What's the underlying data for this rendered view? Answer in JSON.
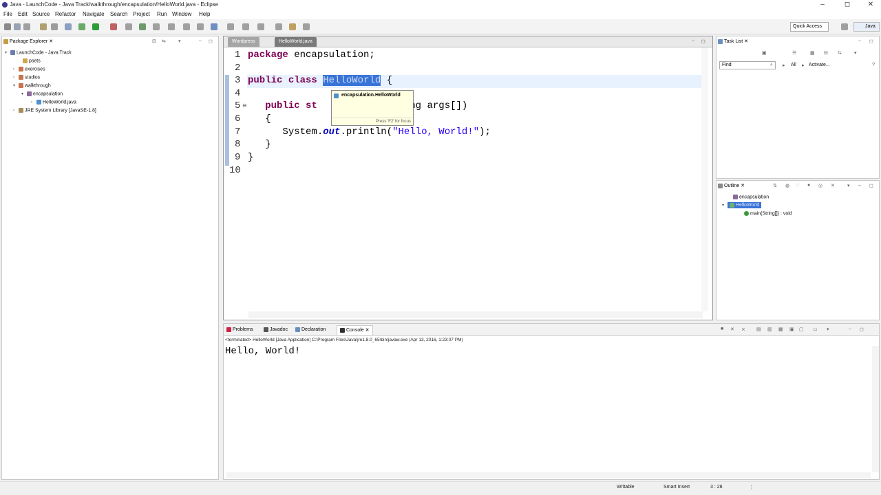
{
  "window": {
    "title": "Java - LaunchCode - Java Track/walkthrough/encapsulation/HelloWorld.java - Eclipse"
  },
  "menu": [
    "File",
    "Edit",
    "Source",
    "Refactor",
    "Navigate",
    "Search",
    "Project",
    "Run",
    "Window",
    "Help"
  ],
  "toolbar": {
    "quick_access": "Quick Access",
    "perspective": "Java"
  },
  "package_explorer": {
    "title": "Package Explorer",
    "items": [
      "LaunchCode - Java Track",
      "psets",
      "exercises",
      "studios",
      "walkthrough",
      "encapsulation",
      "HelloWorld.java",
      "JRE System Library [JavaSE-1.8]"
    ]
  },
  "editor": {
    "tabs": [
      "Wordpress",
      "HelloWorld.java"
    ],
    "lines": [
      {
        "n": "1"
      },
      {
        "n": "2"
      },
      {
        "n": "3"
      },
      {
        "n": "4"
      },
      {
        "n": "5"
      },
      {
        "n": "6"
      },
      {
        "n": "7"
      },
      {
        "n": "8"
      },
      {
        "n": "9"
      },
      {
        "n": "10"
      }
    ],
    "code": {
      "l1_kw": "package",
      "l1_rest": " encapsulation;",
      "l3_kw1": "public",
      "l3_kw2": "class",
      "l3_sel": "HelloWorld",
      "l3_rest": " {",
      "l5_kw1": "public",
      "l5_kw2": "st",
      "l5_rest": "n(String args[])",
      "l6": "{",
      "l7_a": "System.",
      "l7_fld": "out",
      "l7_b": ".println(",
      "l7_str": "\"Hello, World!\"",
      "l7_c": ");",
      "l8": "}",
      "l9": "}"
    },
    "hover": {
      "title": "encapsulation.HelloWorld",
      "hint": "Press 'F2' for focus"
    }
  },
  "task_list": {
    "title": "Task List",
    "find": "Find",
    "all": "All",
    "activate": "Activate..."
  },
  "outline": {
    "title": "Outline",
    "items": [
      "encapsulation",
      "HelloWorld",
      "main(String[]) : void"
    ]
  },
  "console": {
    "tabs": [
      "Problems",
      "Javadoc",
      "Declaration",
      "Console"
    ],
    "label": "<terminated> HelloWorld [Java Application] C:\\Program Files\\Java\\jre1.8.0_65\\bin\\javaw.exe (Apr 13, 2016, 1:23:07 PM)",
    "output": "Hello, World!"
  },
  "status": {
    "writable": "Writable",
    "insert": "Smart Insert",
    "position": "3 : 28"
  },
  "colors": {
    "keyword": "#7f0055",
    "string": "#2a00ff",
    "selection": "#3874d8",
    "hover_bg": "#ffffe1"
  }
}
